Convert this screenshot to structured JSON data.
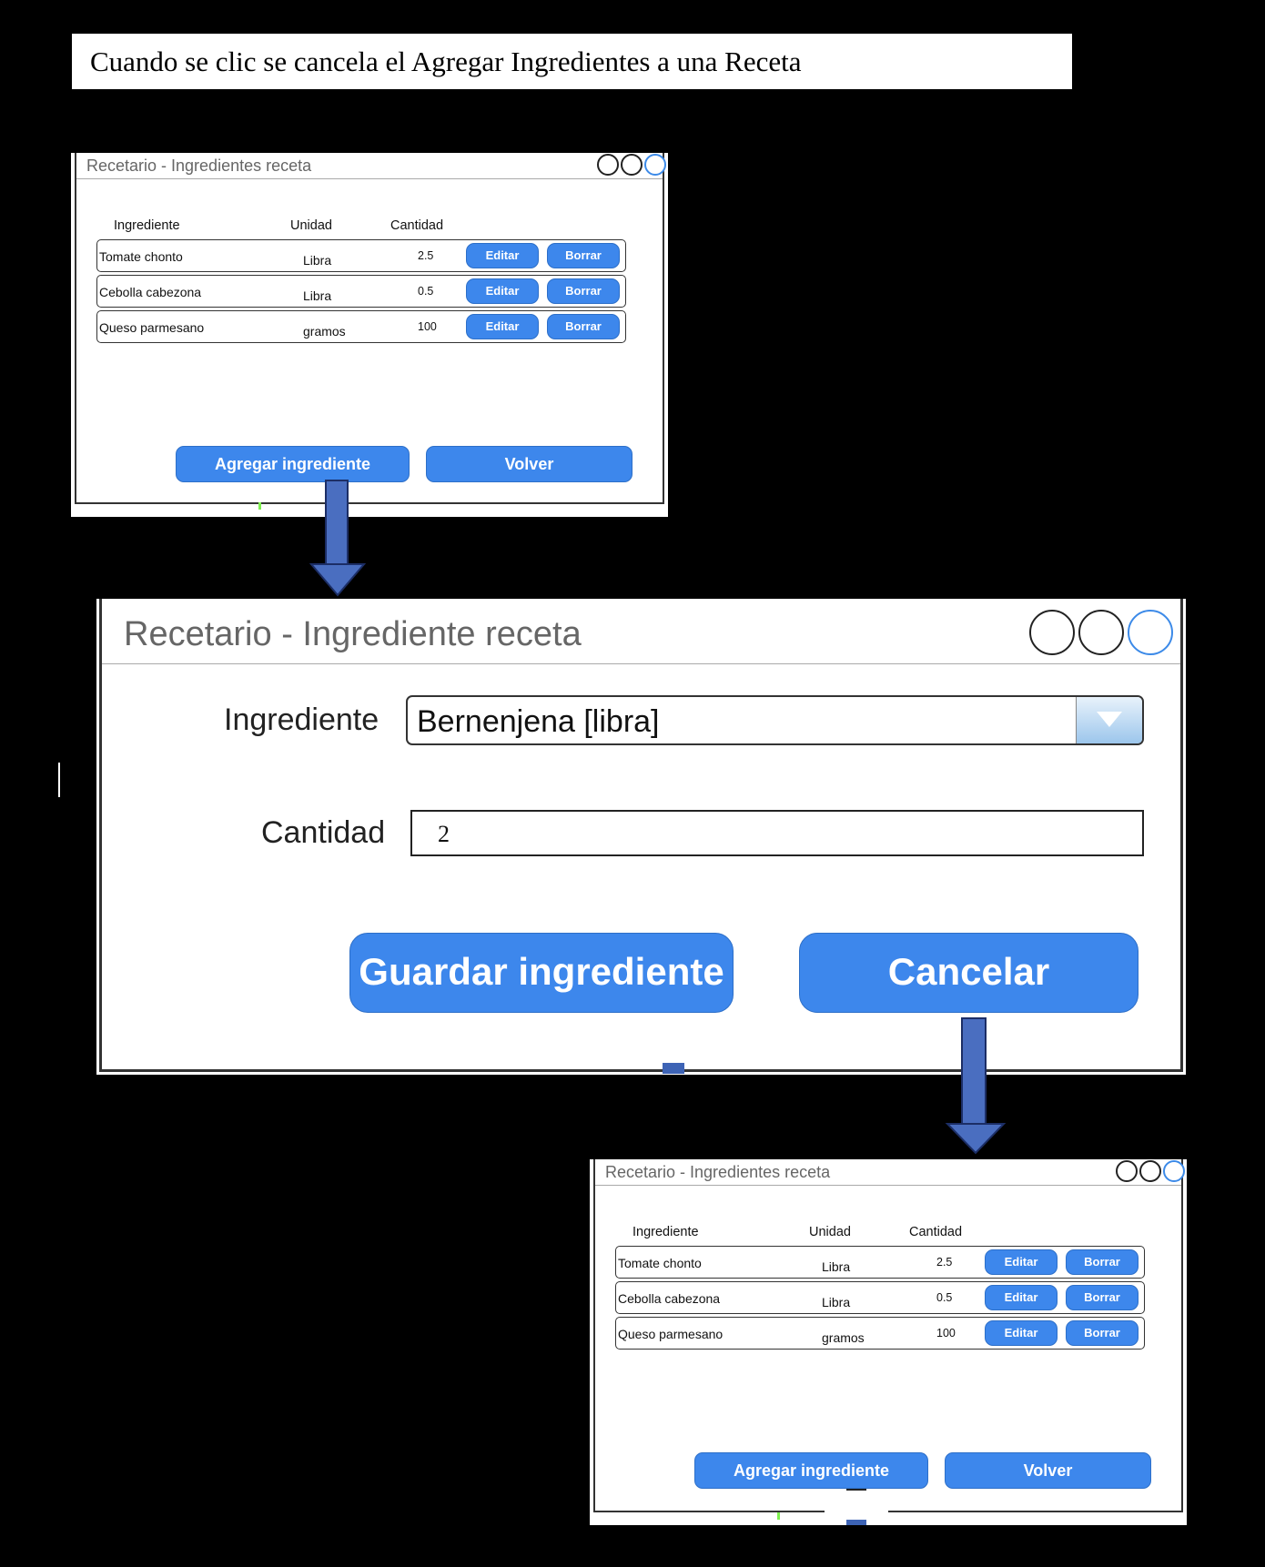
{
  "caption": "Cuando se clic se cancela el  Agregar Ingredientes a una Receta",
  "colors": {
    "accent": "#3d87ec",
    "arrow": "#4a6ec0",
    "background": "#000000"
  },
  "list_window": {
    "title": "Recetario - Ingredientes receta",
    "window_controls": [
      "circle-icon",
      "circle-icon",
      "circle-icon"
    ],
    "columns": [
      "Ingrediente",
      "Unidad",
      "Cantidad"
    ],
    "rows": [
      {
        "ingrediente": "Tomate chonto",
        "unidad": "Libra",
        "cantidad": "2.5"
      },
      {
        "ingrediente": "Cebolla cabezona",
        "unidad": "Libra",
        "cantidad": "0.5"
      },
      {
        "ingrediente": "Queso parmesano",
        "unidad": "gramos",
        "cantidad": "100"
      }
    ],
    "edit_label": "Editar",
    "delete_label": "Borrar",
    "add_label": "Agregar ingrediente",
    "back_label": "Volver"
  },
  "dialog": {
    "title": "Recetario - Ingrediente receta",
    "ingrediente_label": "Ingrediente",
    "ingrediente_value": "Bernenjena [libra]",
    "cantidad_label": "Cantidad",
    "cantidad_value": "2",
    "save_label": "Guardar ingrediente",
    "cancel_label": "Cancelar"
  }
}
